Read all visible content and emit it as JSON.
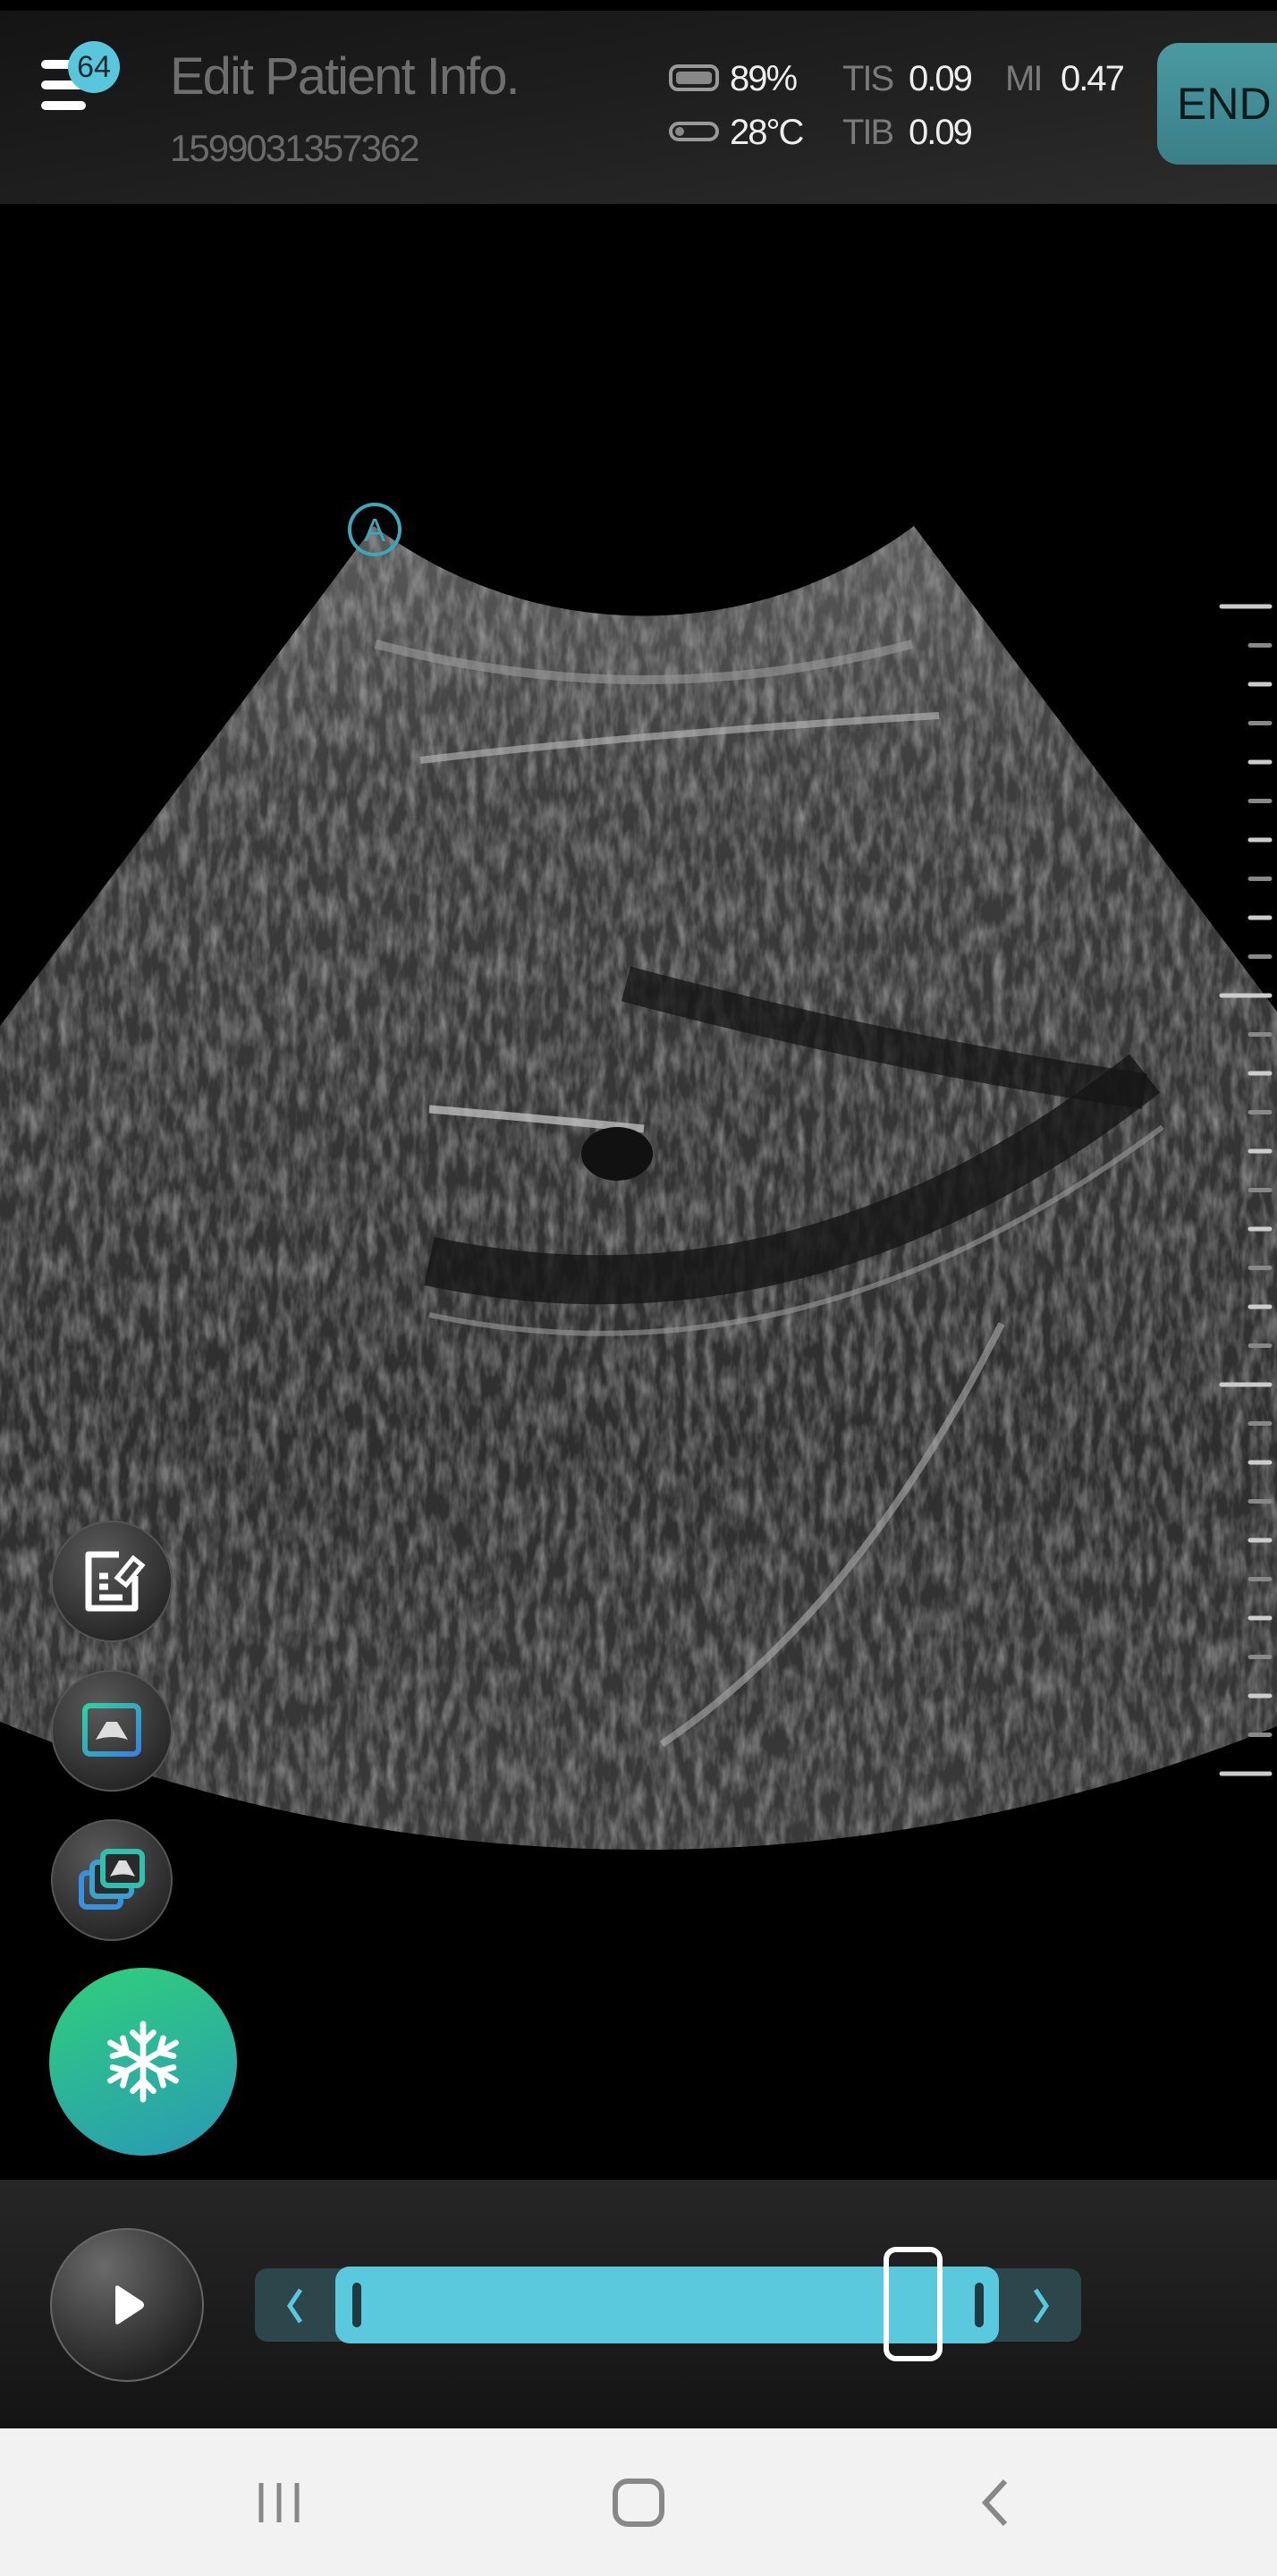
{
  "header": {
    "menu_badge": "64",
    "title": "Edit Patient Info.",
    "patient_id": "1599031357362",
    "battery": "89%",
    "temperature": "28°C",
    "tis_label": "TIS",
    "tis_value": "0.09",
    "mi_label": "MI",
    "mi_value": "0.47",
    "tib_label": "TIB",
    "tib_value": "0.09",
    "end_label": "END"
  },
  "image": {
    "orientation_marker": "A"
  },
  "side_tools": [
    {
      "icon": "annotate-icon"
    },
    {
      "icon": "single-image-icon"
    },
    {
      "icon": "multi-image-icon"
    },
    {
      "icon": "snowflake-icon"
    }
  ],
  "cine": {
    "playhead_position": 0.87,
    "range_start": 0.0,
    "range_end": 1.0
  },
  "colors": {
    "accent": "#5bc9dd",
    "freeze_start": "#2fd07a",
    "freeze_end": "#2a9fb0",
    "end_button": "#3d8a92"
  }
}
